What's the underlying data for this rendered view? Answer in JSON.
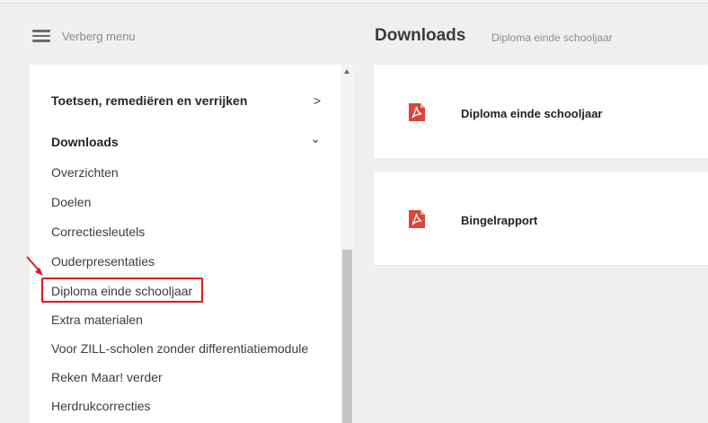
{
  "header": {
    "hide_menu_label": "Verberg menu",
    "page_title": "Downloads",
    "breadcrumb": "Diploma einde schooljaar"
  },
  "sidebar": {
    "sections": [
      {
        "label": "Toetsen, remediëren en verrijken",
        "chevron": ">"
      },
      {
        "label": "Downloads",
        "chevron": "⌄"
      }
    ],
    "items": [
      {
        "label": "Overzichten"
      },
      {
        "label": "Doelen"
      },
      {
        "label": "Correctiesleutels"
      },
      {
        "label": "Ouderpresentaties"
      },
      {
        "label": "Diploma einde schooljaar",
        "highlighted": true
      },
      {
        "label": "Extra materialen"
      },
      {
        "label": "Voor ZILL-scholen zonder differentiatiemodule"
      },
      {
        "label": "Reken Maar! verder"
      },
      {
        "label": "Herdrukcorrecties"
      }
    ]
  },
  "cards": [
    {
      "label": "Diploma einde schooljaar",
      "icon": "pdf-icon"
    },
    {
      "label": "Bingelrapport",
      "icon": "pdf-icon"
    }
  ],
  "colors": {
    "highlight": "#e4161b",
    "pdf_red": "#d9463a",
    "background": "#efefef"
  }
}
